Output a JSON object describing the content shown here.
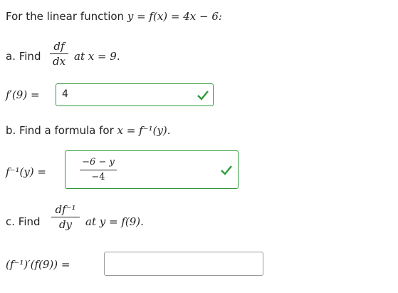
{
  "header": {
    "intro": "For the linear function ",
    "expr": "y = f(x) = 4x − 6:"
  },
  "part_a": {
    "label": "a. Find",
    "frac_num": "df",
    "frac_den": "dx",
    "at_text": "at x = 9.",
    "lhs": "f′(9) =",
    "answer": "4",
    "status_icon": "green-checkmark"
  },
  "part_b": {
    "label": "b. Find a formula for",
    "formula": "x = f⁻¹(y).",
    "lhs": "f⁻¹(y) =",
    "answer_num": "−6 − y",
    "answer_den": "−4",
    "status_icon": "green-checkmark"
  },
  "part_c": {
    "label": "c. Find",
    "frac_num": "df⁻¹",
    "frac_den": "dy",
    "at_text": "at y = f(9).",
    "lhs": "(f⁻¹)′(f(9)) =",
    "answer": ""
  },
  "colors": {
    "correct_border": "#2e9a3a",
    "empty_border": "#9a9a9a"
  }
}
